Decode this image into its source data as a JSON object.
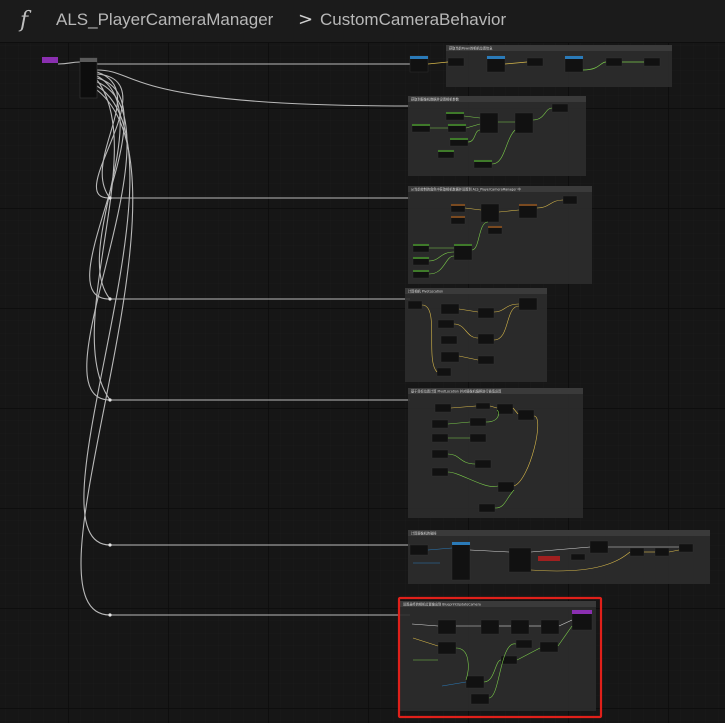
{
  "breadcrumb": {
    "function_icon": "f",
    "blueprint": "ALS_PlayerCameraManager",
    "separator": ">",
    "graph": "CustomCameraBehavior"
  },
  "comments": [
    "获取当前Pawn的相机位置信息",
    "获取到摄像机数据并设置相机参数",
    "从当前控制的角色中获取相机数据并设置到 ALS_PlayerCameraManager 中",
    "计算相机 PivotLocation",
    "基于目标位置计算 PivotLocation 并对摄像机偏移进行插值运算",
    "计算摄像机的碰撞",
    "设置最终的相机位置输出到 BlueprintUpdateCamera"
  ],
  "highlight_color": "#e0201a",
  "accent_colors": {
    "event_node": "#8a2fb0",
    "exec_wire": "#d8d8d8",
    "float_wire": "#7acb4a",
    "struct_wire": "#2a7ab8",
    "vector_wire": "#d7b84a"
  }
}
